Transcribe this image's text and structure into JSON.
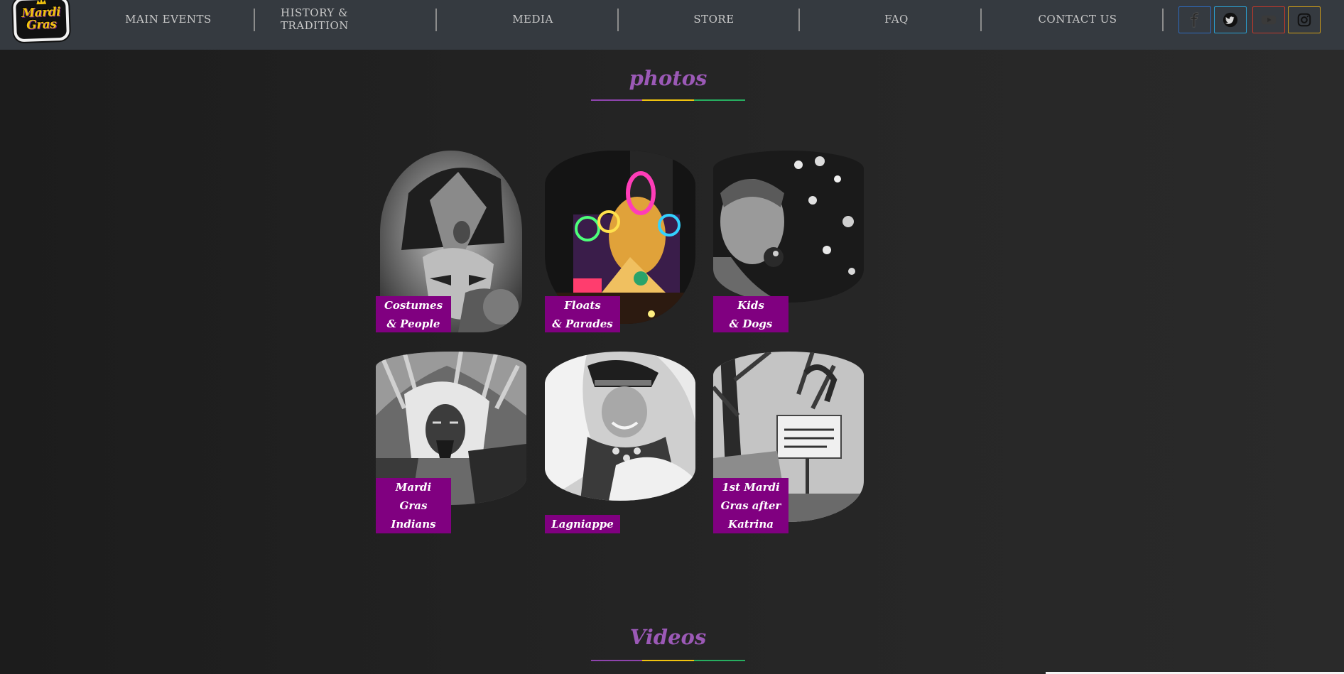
{
  "logo": {
    "line1": "Mardi",
    "line2": "Gras"
  },
  "nav": {
    "items": [
      "MAIN EVENTS",
      "HISTORY & TRADITION",
      "MEDIA",
      "STORE",
      "FAQ",
      "CONTACT US"
    ]
  },
  "social": [
    {
      "name": "facebook-icon",
      "color": "#2e6bbf"
    },
    {
      "name": "twitter-icon",
      "color": "#2aa3d6"
    },
    {
      "name": "youtube-icon",
      "color": "#c0392b"
    },
    {
      "name": "instagram-icon",
      "color": "#d4a017"
    }
  ],
  "colors": {
    "purple": "#800080",
    "heading": "#9b59b6",
    "gold": "#f1c40f",
    "green": "#27ae60"
  },
  "photos_section": {
    "title": "photos"
  },
  "gallery": [
    {
      "lines": [
        "Costumes",
        "& People"
      ]
    },
    {
      "lines": [
        "Floats",
        "& Parades"
      ]
    },
    {
      "lines": [
        "Kids",
        "& Dogs"
      ]
    },
    {
      "lines": [
        "Mardi",
        "Gras",
        "Indians"
      ]
    },
    {
      "lines": [
        "Lagniappe"
      ]
    },
    {
      "lines": [
        "1st Mardi",
        "Gras after",
        "Katrina"
      ]
    }
  ],
  "videos_section": {
    "title": "Videos"
  }
}
